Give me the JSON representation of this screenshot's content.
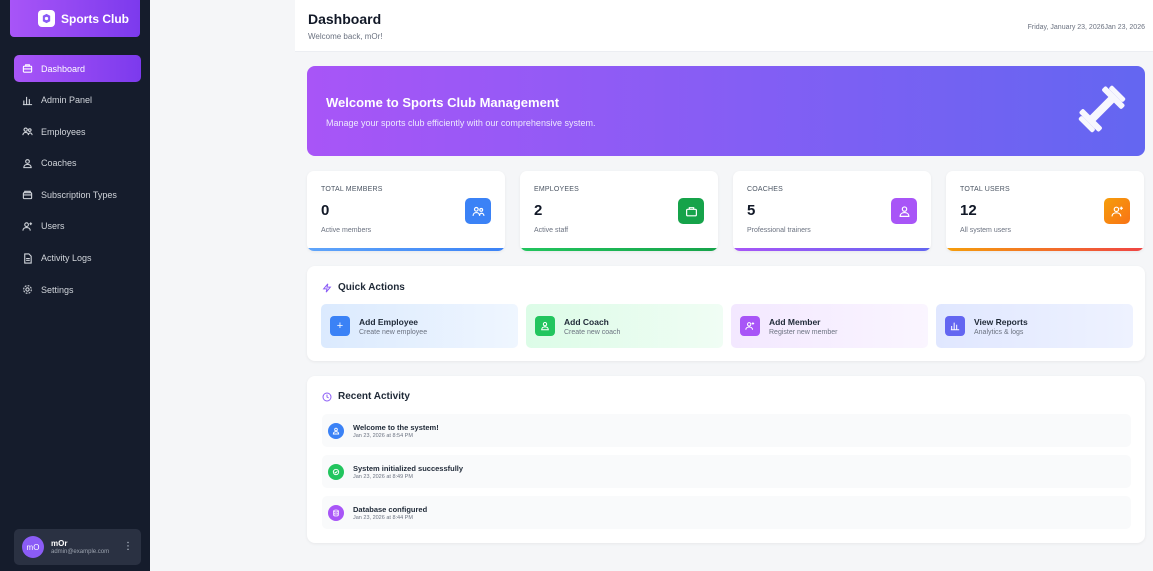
{
  "app": {
    "brand": "Sports Club"
  },
  "sidebar": {
    "items": [
      {
        "label": "Dashboard",
        "icon": "briefcase-icon"
      },
      {
        "label": "Admin Panel",
        "icon": "bar-chart-icon"
      },
      {
        "label": "Employees",
        "icon": "users-icon"
      },
      {
        "label": "Coaches",
        "icon": "user-icon"
      },
      {
        "label": "Subscription Types",
        "icon": "package-icon"
      },
      {
        "label": "Users",
        "icon": "user-plus-icon"
      },
      {
        "label": "Activity Logs",
        "icon": "file-text-icon"
      },
      {
        "label": "Settings",
        "icon": "gear-icon"
      }
    ],
    "active_item": "Dashboard",
    "user": {
      "initials": "mO",
      "name": "mOr",
      "email": "admin@example.com"
    }
  },
  "header": {
    "title": "Dashboard",
    "subtitle": "Welcome back, mOr!",
    "date": "Friday, January 23, 2026Jan 23, 2026"
  },
  "banner": {
    "title": "Welcome to Sports Club Management",
    "subtitle": "Manage your sports club efficiently with our comprehensive system.",
    "icon": "dumbbell-icon"
  },
  "stats": [
    {
      "label": "TOTAL MEMBERS",
      "value": "0",
      "desc": "Active members",
      "color": "#2563eb",
      "bar": "#60a5fa"
    },
    {
      "label": "EMPLOYEES",
      "value": "2",
      "desc": "Active staff",
      "color": "#16a34a",
      "bar": "#22c55e"
    },
    {
      "label": "COACHES",
      "value": "5",
      "desc": "Professional trainers",
      "color": "#9333ea",
      "bar": "#8b5cf6"
    },
    {
      "label": "TOTAL USERS",
      "value": "12",
      "desc": "All system users",
      "color": "#f59e0b",
      "bar": "#f97316"
    }
  ],
  "quick_actions": {
    "title": "Quick Actions",
    "items": [
      {
        "title": "Add Employee",
        "sub": "Create new employee",
        "icon": "plus-icon"
      },
      {
        "title": "Add Coach",
        "sub": "Create new coach",
        "icon": "user-icon"
      },
      {
        "title": "Add Member",
        "sub": "Register new member",
        "icon": "user-plus-icon"
      },
      {
        "title": "View Reports",
        "sub": "Analytics & logs",
        "icon": "bar-chart-icon"
      }
    ]
  },
  "recent_activity": {
    "title": "Recent Activity",
    "items": [
      {
        "title": "Welcome to the system!",
        "time": "Jan 23, 2026 at 8:54 PM",
        "color": "#3b82f6"
      },
      {
        "title": "System initialized successfully",
        "time": "Jan 23, 2026 at 8:49 PM",
        "color": "#22c55e"
      },
      {
        "title": "Database configured",
        "time": "Jan 23, 2026 at 8:44 PM",
        "color": "#a855f7"
      }
    ]
  }
}
